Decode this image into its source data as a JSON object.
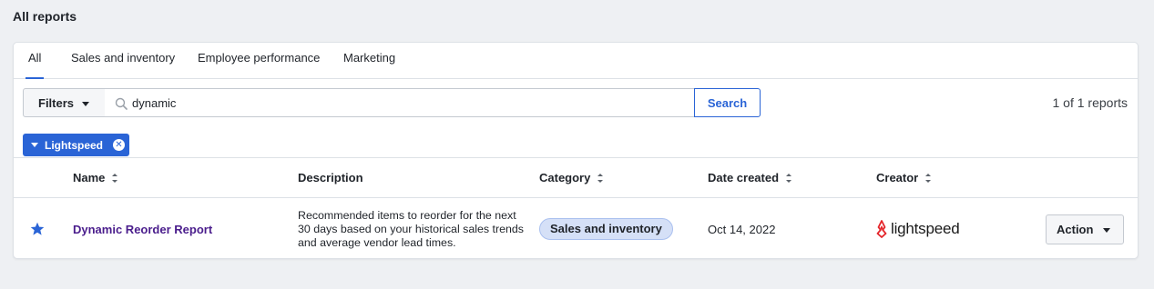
{
  "page": {
    "title": "All reports"
  },
  "tabs": [
    {
      "label": "All",
      "active": true
    },
    {
      "label": "Sales and inventory",
      "active": false
    },
    {
      "label": "Employee performance",
      "active": false
    },
    {
      "label": "Marketing",
      "active": false
    }
  ],
  "toolbar": {
    "filters_label": "Filters",
    "search_value": "dynamic",
    "search_button_label": "Search",
    "report_count": "1 of 1 reports"
  },
  "active_filter": {
    "label": "Lightspeed"
  },
  "table": {
    "columns": [
      {
        "label": "Name",
        "sortable": true
      },
      {
        "label": "Description",
        "sortable": false
      },
      {
        "label": "Category",
        "sortable": true
      },
      {
        "label": "Date created",
        "sortable": true
      },
      {
        "label": "Creator",
        "sortable": true
      }
    ],
    "rows": [
      {
        "favorite": true,
        "name": "Dynamic Reorder Report",
        "description": "Recommended items to reorder for the next 30 days based on your historical sales trends and average vendor lead times.",
        "category": "Sales and inventory",
        "date_created": "Oct 14, 2022",
        "creator_logo_text": "lightspeed",
        "action_label": "Action"
      }
    ]
  },
  "colors": {
    "accent": "#2a64d6",
    "report_link": "#4a1d8c",
    "logo_red": "#e4252a",
    "badge_bg": "#d5e0f7"
  },
  "icons": {
    "search": "search-icon",
    "favorite": "star-icon",
    "filter_remove": "close-icon",
    "dropdown": "caret-down-icon",
    "sort": "sort-icon",
    "creator": "lightspeed-logo-icon"
  }
}
